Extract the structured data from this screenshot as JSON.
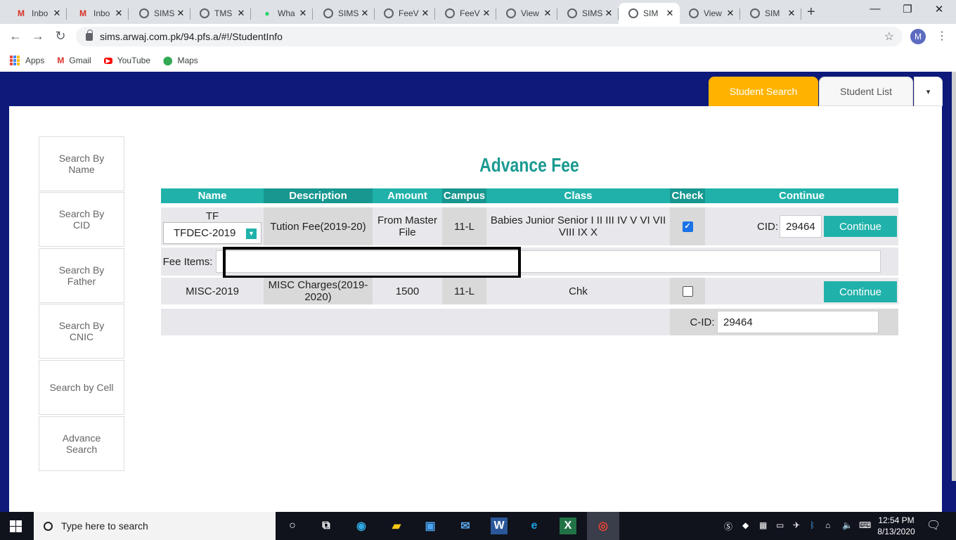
{
  "browser": {
    "tabs": [
      {
        "title": "Inbo",
        "icon": "gmail-icon",
        "active": false
      },
      {
        "title": "Inbo",
        "icon": "gmail-icon",
        "active": false
      },
      {
        "title": "SIMS",
        "icon": "globe-icon",
        "active": false
      },
      {
        "title": "TMS",
        "icon": "globe-icon",
        "active": false
      },
      {
        "title": "Wha",
        "icon": "whatsapp-icon",
        "active": false
      },
      {
        "title": "SIMS",
        "icon": "globe-icon",
        "active": false
      },
      {
        "title": "FeeV",
        "icon": "globe-icon",
        "active": false
      },
      {
        "title": "FeeV",
        "icon": "globe-icon",
        "active": false
      },
      {
        "title": "View",
        "icon": "globe-icon",
        "active": false
      },
      {
        "title": "SIMS",
        "icon": "globe-icon",
        "active": false
      },
      {
        "title": "SIM",
        "icon": "globe-icon",
        "active": true
      },
      {
        "title": "View",
        "icon": "globe-icon",
        "active": false
      },
      {
        "title": "SIM",
        "icon": "globe-icon",
        "active": false
      }
    ],
    "url": "sims.arwaj.com.pk/94.pfs.a/#!/StudentInfo",
    "profile_initial": "M",
    "bookmarks": [
      {
        "label": "Apps"
      },
      {
        "label": "Gmail"
      },
      {
        "label": "YouTube"
      },
      {
        "label": "Maps"
      }
    ]
  },
  "topnav": {
    "student_search": "Student Search",
    "student_list": "Student List",
    "dropdown_caret": "▾"
  },
  "sidebar": {
    "items": [
      {
        "label": "Search By Name"
      },
      {
        "label": "Search By CID"
      },
      {
        "label": "Search By Father"
      },
      {
        "label": "Search By CNIC"
      },
      {
        "label": "Search by Cell"
      },
      {
        "label": "Advance Search"
      }
    ]
  },
  "main": {
    "title": "Advance Fee",
    "columns": [
      "Name",
      "Description",
      "Amount",
      "Campus",
      "Class",
      "Check",
      "Continue"
    ],
    "row1": {
      "name_top": "TF",
      "name_select": "TFDEC-2019",
      "description": "Tution Fee(2019-20)",
      "amount": "From Master File",
      "campus": "11-L",
      "class": "Babies Junior Senior I II III IV V VI VII VIII IX X",
      "checked": true,
      "cid_label": "CID:",
      "cid_value": "29464",
      "continue_label": "Continue"
    },
    "fee_items": {
      "label": "Fee Items:",
      "value": ""
    },
    "row2": {
      "name": "MISC-2019",
      "description": "MISC Charges(2019-2020)",
      "amount": "1500",
      "campus": "11-L",
      "class": "Chk",
      "checked": false,
      "continue_label": "Continue"
    },
    "footer": {
      "cid_label": "C-ID:",
      "cid_value": "29464"
    }
  },
  "taskbar": {
    "search_placeholder": "Type here to search",
    "time": "12:54 PM",
    "date": "8/13/2020"
  }
}
